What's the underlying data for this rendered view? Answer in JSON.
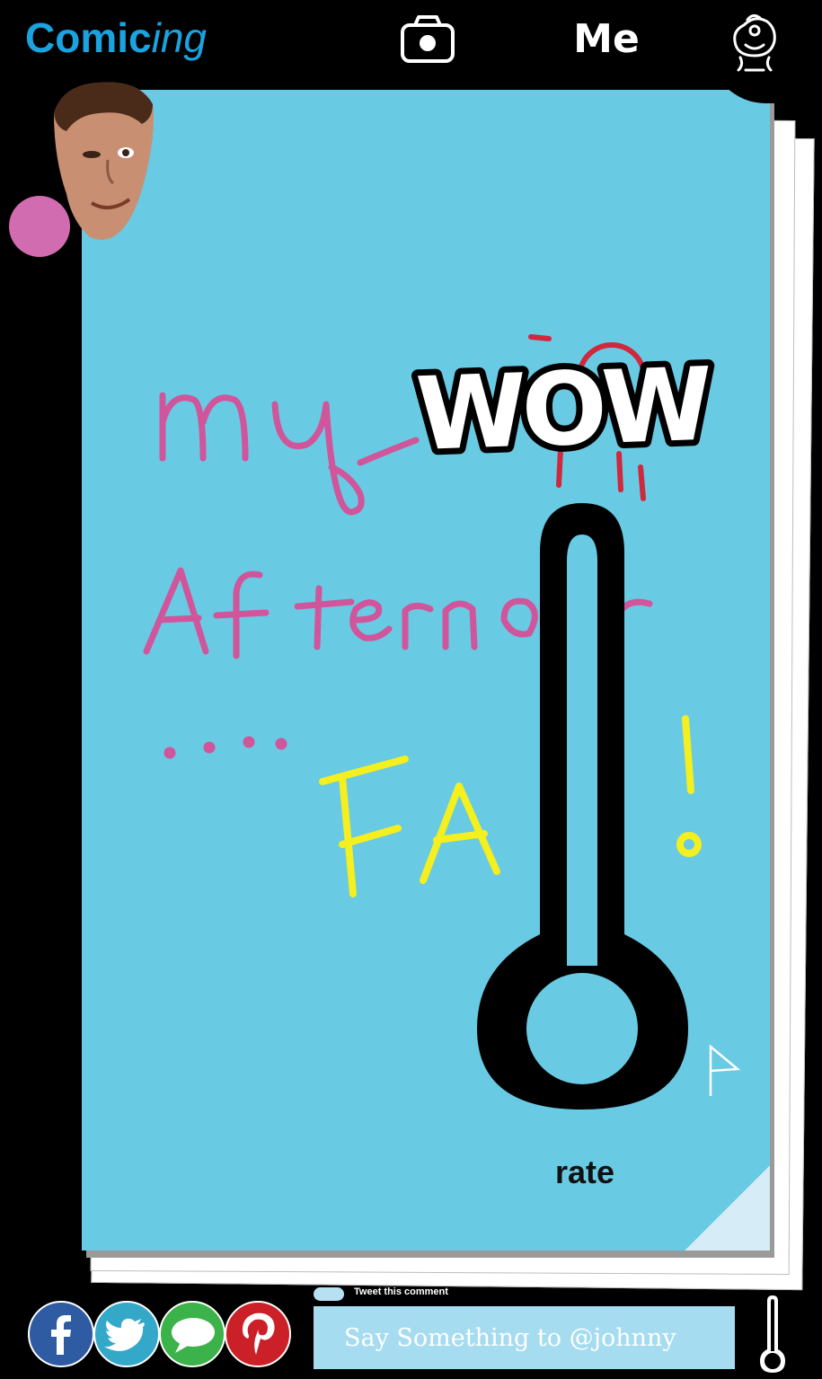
{
  "header": {
    "logo_bold": "Comic",
    "logo_italic": "ing",
    "me_label": "Me",
    "icons": {
      "camera": "camera-icon",
      "profile": "baby-face-icon"
    }
  },
  "comic": {
    "background_color": "#69cae3",
    "drawing": {
      "line1": "my",
      "line2": "Afternoon",
      "line3": "...",
      "line4": "FAIL!",
      "pink_ink": "#d0559a",
      "yellow_ink": "#f4ef1e"
    },
    "sticker": "WOW",
    "rating_widget": {
      "label": "rate",
      "icon": "thermometer-icon"
    }
  },
  "author": {
    "avatar_icon": "avatar-face",
    "badge_color": "#d26cb1"
  },
  "share": {
    "facebook": "facebook-icon",
    "twitter": "twitter-icon",
    "comment": "speech-bubble-icon",
    "pinterest": "pinterest-icon",
    "tweet_label": "Tweet this comment",
    "comment_placeholder": "Say Something to @johnny"
  }
}
